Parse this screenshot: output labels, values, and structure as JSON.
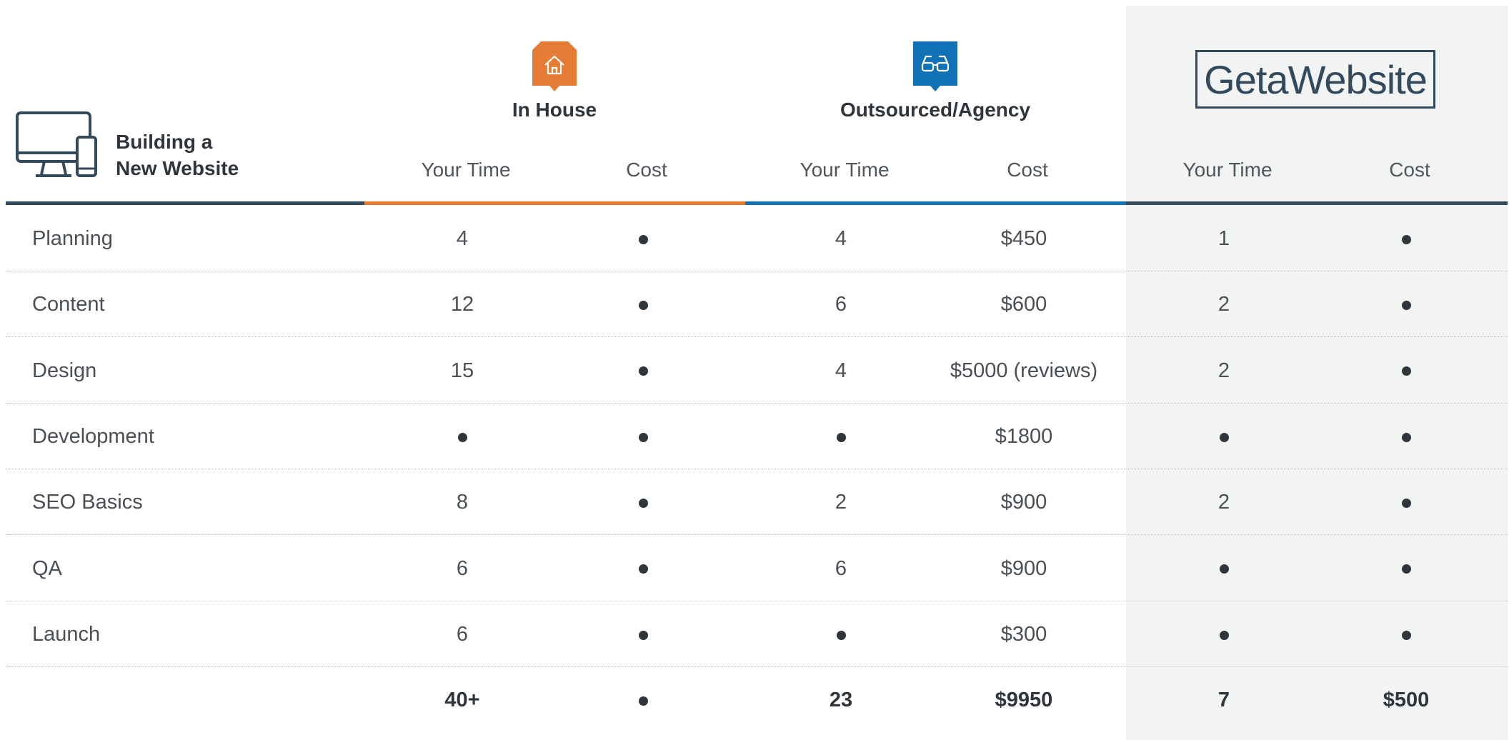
{
  "header": {
    "title_line1": "Building a",
    "title_line2": "New Website",
    "in_house": {
      "title": "In House",
      "color": "#e57c35"
    },
    "agency": {
      "title": "Outsourced/Agency",
      "color": "#1171b6"
    },
    "brand": {
      "name": "GetaWebsite",
      "color": "#33495c"
    }
  },
  "subheaders": {
    "in_house_time": "Your Time",
    "in_house_cost": "Cost",
    "agency_time": "Your Time",
    "agency_cost": "Cost",
    "brand_time": "Your Time",
    "brand_cost": "Cost"
  },
  "rows": [
    {
      "task": "Planning",
      "ih_time": "4",
      "ih_cost": "●",
      "ag_time": "4",
      "ag_cost": "$450",
      "gw_time": "1",
      "gw_cost": "●"
    },
    {
      "task": "Content",
      "ih_time": "12",
      "ih_cost": "●",
      "ag_time": "6",
      "ag_cost": "$600",
      "gw_time": "2",
      "gw_cost": "●"
    },
    {
      "task": "Design",
      "ih_time": "15",
      "ih_cost": "●",
      "ag_time": "4",
      "ag_cost": "$5000 (reviews)",
      "gw_time": "2",
      "gw_cost": "●"
    },
    {
      "task": "Development",
      "ih_time": "●",
      "ih_cost": "●",
      "ag_time": "●",
      "ag_cost": "$1800",
      "gw_time": "●",
      "gw_cost": "●"
    },
    {
      "task": "SEO Basics",
      "ih_time": "8",
      "ih_cost": "●",
      "ag_time": "2",
      "ag_cost": "$900",
      "gw_time": "2",
      "gw_cost": "●"
    },
    {
      "task": "QA",
      "ih_time": "6",
      "ih_cost": "●",
      "ag_time": "6",
      "ag_cost": "$900",
      "gw_time": "●",
      "gw_cost": "●"
    },
    {
      "task": "Launch",
      "ih_time": "6",
      "ih_cost": "●",
      "ag_time": "●",
      "ag_cost": "$300",
      "gw_time": "●",
      "gw_cost": "●"
    }
  ],
  "totals": {
    "task": "",
    "ih_time": "40+",
    "ih_cost": "●",
    "ag_time": "23",
    "ag_cost": "$9950",
    "gw_time": "7",
    "gw_cost": "$500"
  }
}
